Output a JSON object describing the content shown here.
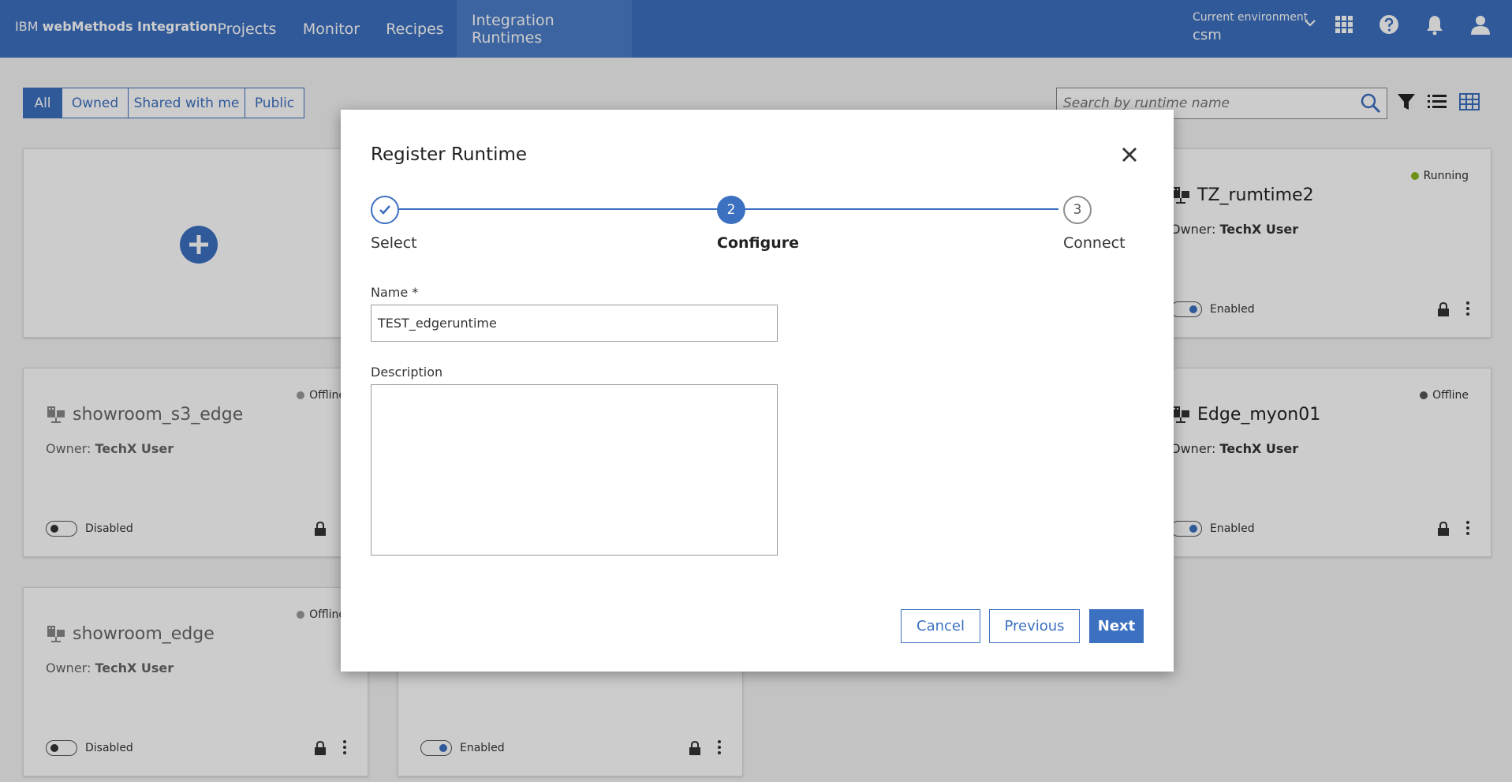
{
  "header": {
    "brand_prefix": "IBM",
    "brand_name": "webMethods Integration",
    "nav": [
      {
        "label": "Projects"
      },
      {
        "label": "Monitor"
      },
      {
        "label": "Recipes"
      },
      {
        "label": "Integration Runtimes"
      }
    ],
    "env_label": "Current environment",
    "env_value": "csm",
    "icons": [
      "app-switcher-icon",
      "help-icon",
      "notification-icon",
      "user-icon"
    ]
  },
  "filters": {
    "segments": [
      "All",
      "Owned",
      "Shared with me",
      "Public"
    ],
    "active": "All",
    "search_placeholder": "Search by runtime name"
  },
  "cards": [
    {
      "name": "TZ_rumtime2",
      "status": "Running",
      "owner_label": "Owner:",
      "owner": "TechX User",
      "toggle": "Enabled"
    },
    {
      "name": "showroom_s3_edge",
      "status": "Offline",
      "owner_label": "Owner:",
      "owner": "TechX User",
      "toggle": "Disabled"
    },
    {
      "name": "Edge_myon01",
      "status": "Offline",
      "owner_label": "Owner:",
      "owner": "TechX User",
      "toggle": "Enabled"
    },
    {
      "name": "showroom_edge",
      "status": "Offline",
      "owner_label": "Owner:",
      "owner": "TechX User",
      "toggle": "Disabled"
    },
    {
      "name": "",
      "status": "",
      "owner_label": "",
      "owner": "",
      "toggle": "Enabled"
    }
  ],
  "colors": {
    "accent": "#3c70c0",
    "running": "#8ab51d",
    "offline": "#999999"
  },
  "modal": {
    "title": "Register Runtime",
    "steps": [
      {
        "label": "Select",
        "number": "1",
        "state": "done"
      },
      {
        "label": "Configure",
        "number": "2",
        "state": "current"
      },
      {
        "label": "Connect",
        "number": "3",
        "state": "todo"
      }
    ],
    "name_label": "Name *",
    "name_value": "TEST_edgeruntime",
    "description_label": "Description",
    "description_value": "",
    "buttons": {
      "cancel": "Cancel",
      "previous": "Previous",
      "next": "Next"
    }
  }
}
